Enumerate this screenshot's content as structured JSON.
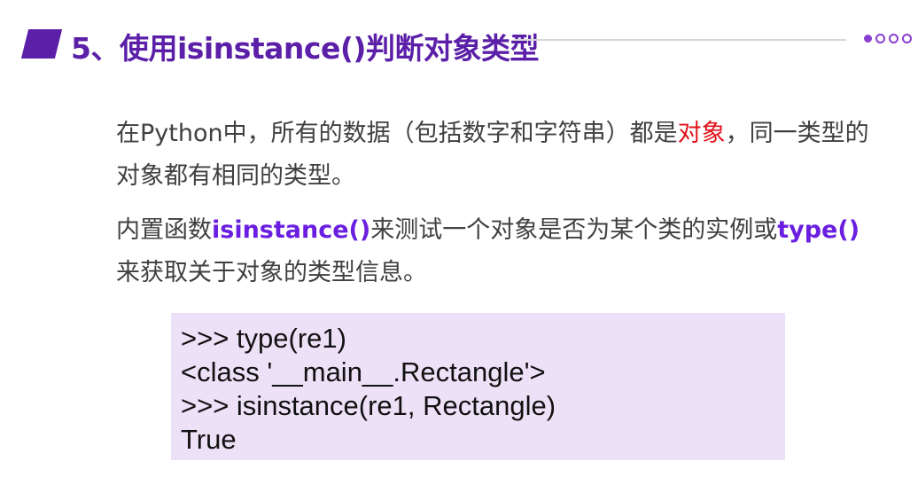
{
  "header": {
    "title": "5、使用isinstance()判断对象类型"
  },
  "paragraph1": {
    "text_before": "在Python中，所有的数据（包括数字和字符串）都是",
    "highlight": "对象",
    "text_after": "，同一类型的对象都有相同的类型。"
  },
  "paragraph2": {
    "text_before": "内置函数",
    "func1": "isinstance()",
    "text_middle": "来测试一个对象是否为某个类的实例或",
    "func2": "type()",
    "text_after": "来获取关于对象的类型信息。"
  },
  "code": {
    "lines": [
      ">>> type(re1)",
      "<class '__main__.Rectangle'>",
      ">>> isinstance(re1, Rectangle)",
      "True"
    ]
  },
  "colors": {
    "accent": "#5b1fa8",
    "highlight_red": "#e0121a",
    "highlight_purple": "#6a1fe0",
    "code_bg": "#ede1f7"
  }
}
